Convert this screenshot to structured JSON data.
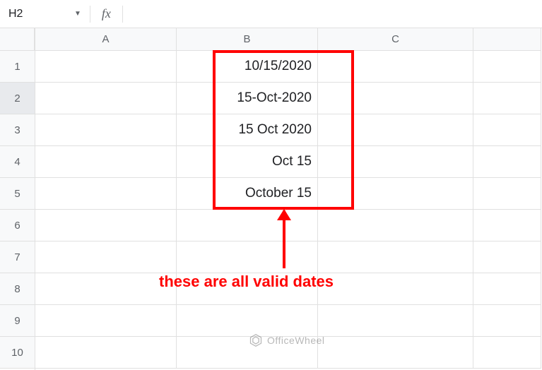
{
  "formula_bar": {
    "name_box": "H2",
    "fx_label": "fx",
    "formula_value": ""
  },
  "columns": [
    "A",
    "B",
    "C",
    ""
  ],
  "rows": [
    "1",
    "2",
    "3",
    "4",
    "5",
    "6",
    "7",
    "8",
    "9",
    "10"
  ],
  "selected_row": "2",
  "cells": {
    "B1": "10/15/2020",
    "B2": "15-Oct-2020",
    "B3": "15 Oct 2020",
    "B4": "Oct 15",
    "B5": "October 15"
  },
  "annotation": {
    "text": "these are all valid dates",
    "color": "#ff0000"
  },
  "watermark": {
    "text": "OfficeWheel"
  },
  "chart_data": {
    "type": "table",
    "title": "",
    "columns": [
      "A",
      "B",
      "C"
    ],
    "rows": [
      {
        "A": "",
        "B": "10/15/2020",
        "C": ""
      },
      {
        "A": "",
        "B": "15-Oct-2020",
        "C": ""
      },
      {
        "A": "",
        "B": "15 Oct 2020",
        "C": ""
      },
      {
        "A": "",
        "B": "Oct 15",
        "C": ""
      },
      {
        "A": "",
        "B": "October 15",
        "C": ""
      }
    ]
  }
}
